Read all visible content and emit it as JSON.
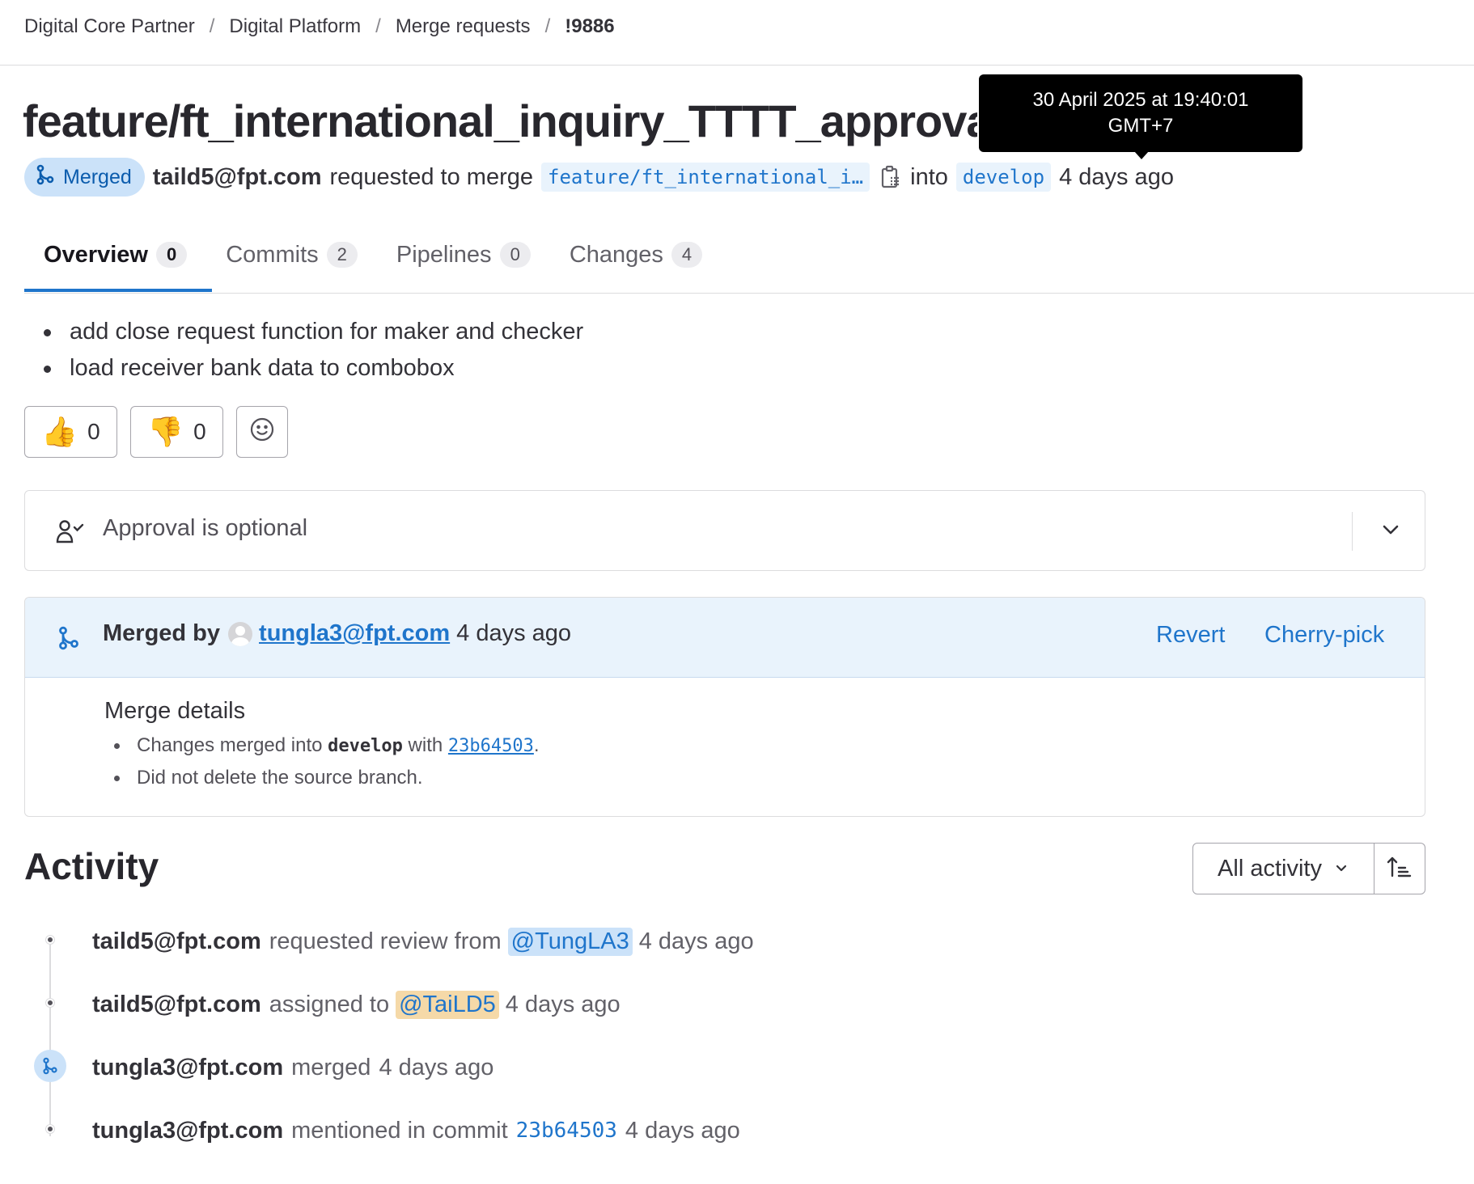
{
  "breadcrumb": {
    "items": [
      "Digital Core Partner",
      "Digital Platform",
      "Merge requests"
    ],
    "separator": "/",
    "current": "!9886"
  },
  "mr": {
    "title": "feature/ft_international_inquiry_TTTT_approval",
    "status": "Merged",
    "author": "taild5@fpt.com",
    "requested_text": "requested to merge",
    "source_branch": "feature/ft_international_i…",
    "into_text": "into",
    "target_branch": "develop",
    "time_ago": "4 days ago"
  },
  "tooltip": {
    "line1": "30 April 2025 at 19:40:01",
    "line2": "GMT+7"
  },
  "tabs": [
    {
      "label": "Overview",
      "count": "0"
    },
    {
      "label": "Commits",
      "count": "2"
    },
    {
      "label": "Pipelines",
      "count": "0"
    },
    {
      "label": "Changes",
      "count": "4"
    }
  ],
  "description": {
    "items": [
      "add close request function for maker and checker",
      "load receiver bank data to combobox"
    ]
  },
  "reactions": {
    "thumbs_up": "0",
    "thumbs_down": "0"
  },
  "approval": {
    "label": "Approval is optional"
  },
  "merge": {
    "merged_by_label": "Merged by",
    "user": "tungla3@fpt.com",
    "time_ago": "4 days ago",
    "revert_label": "Revert",
    "cherry_pick_label": "Cherry-pick",
    "details_heading": "Merge details",
    "detail1_prefix": "Changes merged into",
    "detail1_branch": "develop",
    "detail1_with": "with",
    "detail1_commit": "23b64503",
    "detail1_suffix": ".",
    "detail2": "Did not delete the source branch."
  },
  "activity": {
    "title": "Activity",
    "filter_label": "All activity",
    "items": [
      {
        "user": "taild5@fpt.com",
        "action": "requested review from",
        "mention": "@TungLA3",
        "time": "4 days ago"
      },
      {
        "user": "taild5@fpt.com",
        "action": "assigned to",
        "mention": "@TaiLD5",
        "time": "4 days ago"
      },
      {
        "user": "tungla3@fpt.com",
        "action": "merged",
        "time": "4 days ago"
      },
      {
        "user": "tungla3@fpt.com",
        "action": "mentioned in commit",
        "commit": "23b64503",
        "time": "4 days ago"
      }
    ]
  },
  "colors": {
    "accent": "#1f75cb",
    "merged_badge_bg": "#cbe2f9",
    "merged_panel_bg": "#e9f3fc",
    "tooltip_bg": "#000000"
  }
}
